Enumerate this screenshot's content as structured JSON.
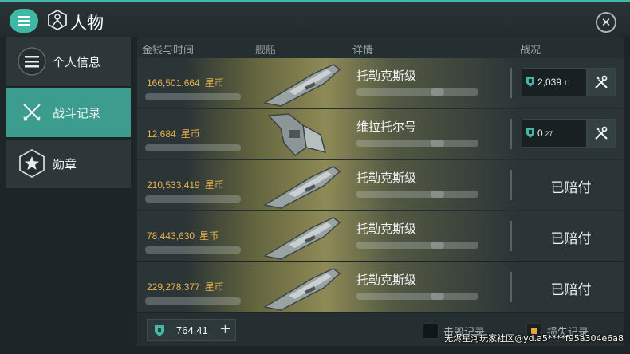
{
  "header": {
    "title": "人物",
    "menu_icon": "menu-icon",
    "logo_icon": "character-emblem-icon",
    "close_icon": "close-icon",
    "close_glyph": "✕"
  },
  "sidebar": {
    "items": [
      {
        "label": "个人信息",
        "icon": "list-icon",
        "active": false
      },
      {
        "label": "战斗记录",
        "icon": "crossed-swords-icon",
        "active": true
      },
      {
        "label": "勋章",
        "icon": "star-hexagon-icon",
        "active": false
      }
    ]
  },
  "table": {
    "columns": [
      "金钱与时间",
      "舰船",
      "详情",
      "战况"
    ],
    "rows": [
      {
        "money": "166,501,664",
        "unit": "星币",
        "ship_name": "托勒克斯级",
        "status": "claim",
        "claim_value": "2,039",
        "claim_decimals": ".11",
        "repair_icon": "repair-tools-icon"
      },
      {
        "money": "12,684",
        "unit": "星币",
        "ship_name": "维拉托尔号",
        "status": "claim",
        "claim_value": "0",
        "claim_decimals": ".27",
        "repair_icon": "repair-tools-icon"
      },
      {
        "money": "210,533,419",
        "unit": "星币",
        "ship_name": "托勒克斯级",
        "status": "paid",
        "status_text": "已赔付"
      },
      {
        "money": "78,443,630",
        "unit": "星币",
        "ship_name": "托勒克斯级",
        "status": "paid",
        "status_text": "已赔付"
      },
      {
        "money": "229,278,377",
        "unit": "星币",
        "ship_name": "托勒克斯级",
        "status": "paid",
        "status_text": "已赔付"
      }
    ]
  },
  "footer": {
    "balance": "764.41",
    "plus": "+",
    "legend": [
      {
        "label": "击毁记录",
        "color": "#111618"
      },
      {
        "label": "损失记录",
        "color": "#e7a63a"
      }
    ]
  },
  "watermark": "无烬星河玩家社区@yd.a5****f95a304e6a8",
  "colors": {
    "accent": "#3fb8a5",
    "money": "#e7b34d",
    "active_tab": "#3c9c8d"
  }
}
